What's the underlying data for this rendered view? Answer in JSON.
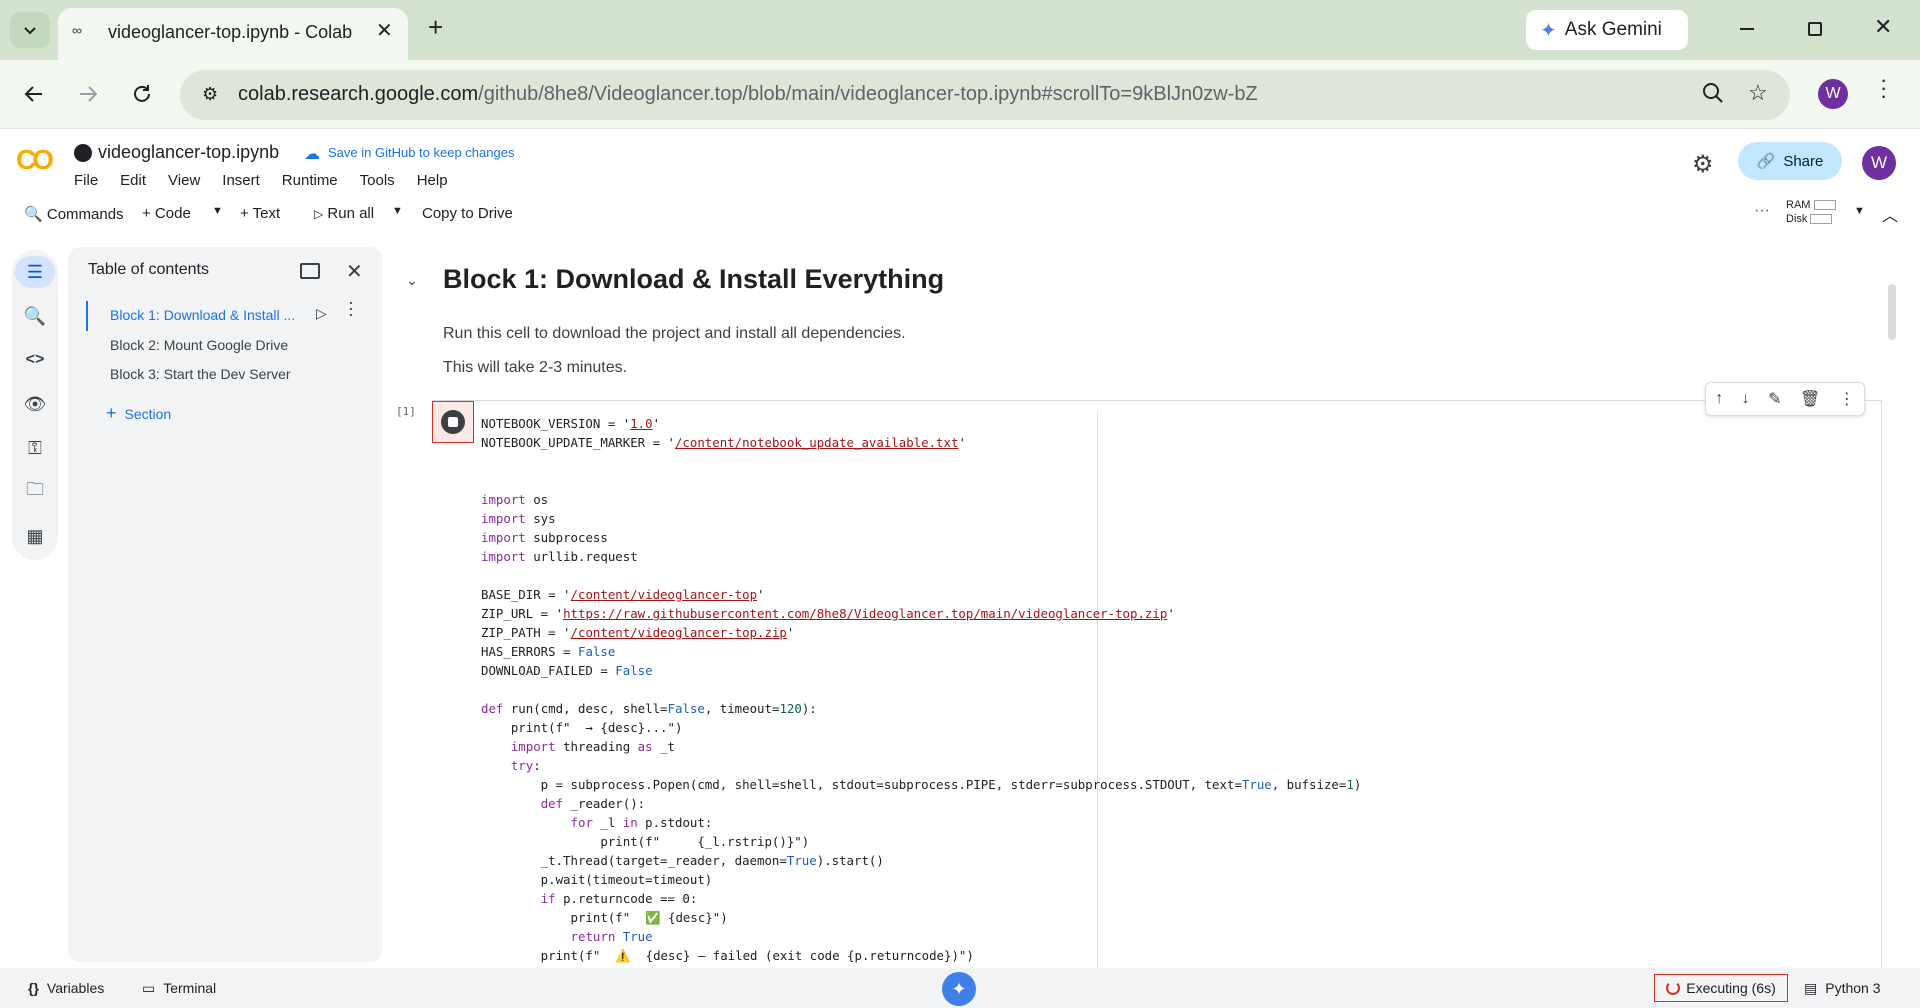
{
  "browser": {
    "tab_title": "videoglancer-top.ipynb - Colab",
    "url_host": "colab.research.google.com",
    "url_path": "/github/8he8/Videoglancer.top/blob/main/videoglancer-top.ipynb#scrollTo=9kBlJn0zw-bZ",
    "gemini_label": "Ask Gemini",
    "profile_initial": "W",
    "accent": "#6f2fa0"
  },
  "notebook": {
    "logo": "CO",
    "filename": "videoglancer-top.ipynb",
    "save_github": "Save in GitHub to keep changes",
    "share": "Share",
    "avatar": "W",
    "menu": [
      "File",
      "Edit",
      "View",
      "Insert",
      "Runtime",
      "Tools",
      "Help"
    ],
    "toolbar": {
      "commands": "Commands",
      "code": "+ Code",
      "text": "+ Text",
      "run_all": "Run all",
      "copy_drive": "Copy to Drive",
      "ram": "RAM",
      "disk": "Disk"
    }
  },
  "toc": {
    "title": "Table of contents",
    "items": [
      "Block 1: Download & Install ...",
      "Block 2: Mount Google Drive",
      "Block 3: Start the Dev Server"
    ],
    "add_section": "Section"
  },
  "main": {
    "heading": "Block 1: Download & Install Everything",
    "para1": "Run this cell to download the project and install all dependencies.",
    "para2": "This will take 2-3 minutes.",
    "exec_count": "[1]"
  },
  "code_lines": [
    "NOTEBOOK_VERSION = '1.0'",
    "NOTEBOOK_UPDATE_MARKER = '/content/notebook_update_available.txt'",
    "",
    "",
    "import os",
    "import sys",
    "import subprocess",
    "import urllib.request",
    "",
    "BASE_DIR = '/content/videoglancer-top'",
    "ZIP_URL = 'https://raw.githubusercontent.com/8he8/Videoglancer.top/main/videoglancer-top.zip'",
    "ZIP_PATH = '/content/videoglancer-top.zip'",
    "HAS_ERRORS = False",
    "DOWNLOAD_FAILED = False",
    "",
    "def run(cmd, desc, shell=False, timeout=120):",
    "    print(f\"  → {desc}...\")",
    "    import threading as _t",
    "    try:",
    "        p = subprocess.Popen(cmd, shell=shell, stdout=subprocess.PIPE, stderr=subprocess.STDOUT, text=True, bufsize=1)",
    "        def _reader():",
    "            for _l in p.stdout:",
    "                print(f\"     {_l.rstrip()}\")",
    "        _t.Thread(target=_reader, daemon=True).start()",
    "        p.wait(timeout=timeout)",
    "        if p.returncode == 0:",
    "            print(f\"  ✅ {desc}\")",
    "            return True",
    "        print(f\"  ⚠️  {desc} — failed (exit code {p.returncode})\")"
  ],
  "status": {
    "variables": "Variables",
    "terminal": "Terminal",
    "executing": "Executing (6s)",
    "kernel": "Python 3"
  }
}
